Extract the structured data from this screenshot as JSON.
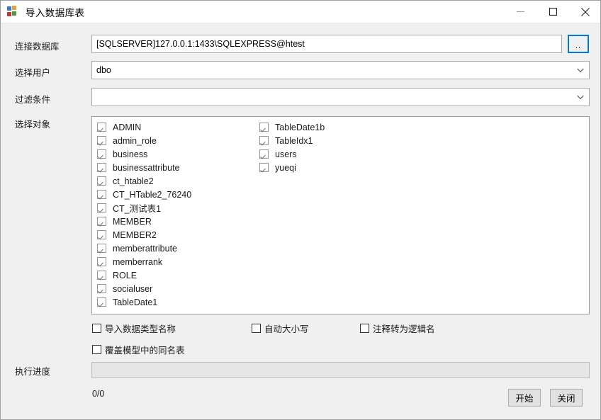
{
  "window": {
    "title": "导入数据库表",
    "icon": "database-import-icon",
    "controls": {
      "minimize": "minimize-icon",
      "maximize": "maximize-icon",
      "close": "close-icon"
    }
  },
  "form": {
    "connection": {
      "label": "连接数据库",
      "value": "[SQLSERVER]127.0.0.1:1433\\SQLEXPRESS@htest",
      "browse_label": ".."
    },
    "user": {
      "label": "选择用户",
      "value": "dbo"
    },
    "filter": {
      "label": "过滤条件",
      "value": "",
      "placeholder": ""
    },
    "objects": {
      "label": "选择对象",
      "column_left": [
        {
          "name": "ADMIN",
          "checked": true
        },
        {
          "name": "admin_role",
          "checked": true
        },
        {
          "name": "business",
          "checked": true
        },
        {
          "name": "businessattribute",
          "checked": true
        },
        {
          "name": "ct_htable2",
          "checked": true
        },
        {
          "name": "CT_HTable2_76240",
          "checked": true
        },
        {
          "name": "CT_测试表1",
          "checked": true
        },
        {
          "name": "MEMBER",
          "checked": true
        },
        {
          "name": "MEMBER2",
          "checked": true
        },
        {
          "name": "memberattribute",
          "checked": true
        },
        {
          "name": "memberrank",
          "checked": true
        },
        {
          "name": "ROLE",
          "checked": true
        },
        {
          "name": "socialuser",
          "checked": true
        },
        {
          "name": "TableDate1",
          "checked": true
        }
      ],
      "column_right": [
        {
          "name": "TableDate1b",
          "checked": true
        },
        {
          "name": "TableIdx1",
          "checked": true
        },
        {
          "name": "users",
          "checked": true
        },
        {
          "name": "yueqi",
          "checked": true
        }
      ]
    }
  },
  "options": [
    {
      "label": "导入数据类型名称",
      "checked": false
    },
    {
      "label": "自动大小写",
      "checked": false
    },
    {
      "label": "注释转为逻辑名",
      "checked": false
    },
    {
      "label": "覆盖模型中的同名表",
      "checked": false
    }
  ],
  "progress": {
    "label": "执行进度",
    "percent": 0,
    "count_text": "0/0"
  },
  "buttons": {
    "start": "开始",
    "close": "关闭"
  },
  "colors": {
    "accent": "#0078d7",
    "window_bg": "#f0f0f0",
    "field_bg": "#ffffff",
    "border": "#a9a9a9"
  }
}
